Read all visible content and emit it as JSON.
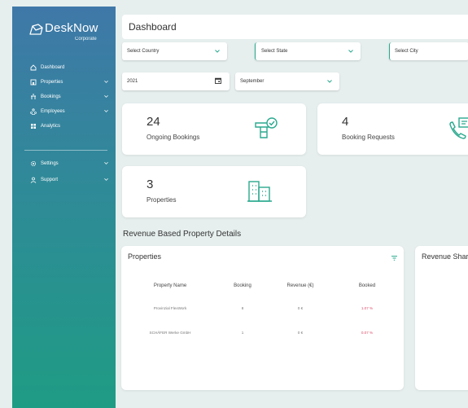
{
  "app": {
    "brand": "DeskNow",
    "subtitle": "Corporate"
  },
  "sidebar": {
    "items": [
      {
        "label": "Dashboard",
        "icon": "home-icon",
        "expandable": false
      },
      {
        "label": "Properties",
        "icon": "building-icon",
        "expandable": true
      },
      {
        "label": "Bookings",
        "icon": "desk-icon",
        "expandable": true
      },
      {
        "label": "Employees",
        "icon": "people-icon",
        "expandable": true
      },
      {
        "label": "Analytics",
        "icon": "grid-icon",
        "expandable": false
      }
    ],
    "bottom_items": [
      {
        "label": "Settings",
        "icon": "gear-icon",
        "expandable": true
      },
      {
        "label": "Support",
        "icon": "support-icon",
        "expandable": true
      }
    ]
  },
  "header": {
    "title": "Dashboard"
  },
  "filters": {
    "country": "Select Country",
    "state": "Select State",
    "city": "Select City",
    "year": "2021",
    "month": "September"
  },
  "stats": [
    {
      "value": "24",
      "label": "Ongoing Bookings",
      "icon": "booking-desk-icon"
    },
    {
      "value": "4",
      "label": "Booking Requests",
      "icon": "phone-request-icon"
    },
    {
      "value": "3",
      "label": "Properties",
      "icon": "office-building-icon"
    }
  ],
  "revenue_section": {
    "title": "Revenue Based Property Details"
  },
  "properties_table": {
    "title": "Properties",
    "columns": [
      "Property Name",
      "Booking",
      "Revenue (€)",
      "Booked"
    ],
    "rows": [
      [
        "Provinzial FlexWork",
        "8",
        "0 €",
        "1.07 %"
      ],
      [
        "SCHÄFER Werke GmbH",
        "1",
        "0 €",
        "0.07 %"
      ]
    ]
  },
  "revenue_share": {
    "title": "Revenue Share"
  },
  "colors": {
    "accent": "#2aa98e",
    "negative": "#e04e6b",
    "sidebar_top": "#3f78a8",
    "sidebar_bottom": "#1f9c84"
  }
}
